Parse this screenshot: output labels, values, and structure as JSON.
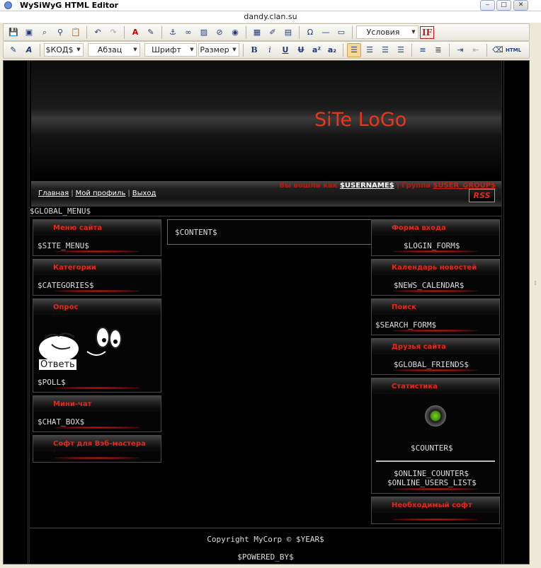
{
  "window": {
    "title": "WySiWyG HTML Editor",
    "url_label": "dandy.clan.su",
    "min_glyph": "‒",
    "max_glyph": "□",
    "close_glyph": "✕"
  },
  "toolbar1": {
    "condition_dropdown": "Условия",
    "if_label": "IF"
  },
  "toolbar2": {
    "code_dropdown": "$КОД$",
    "paragraph_dropdown": "Абзац",
    "font_dropdown": "Шрифт",
    "size_dropdown": "Размер",
    "bold": "B",
    "italic": "i",
    "underline": "U",
    "strike": "U",
    "superscript": "a²",
    "subscript": "a₂",
    "html_label": "HTML"
  },
  "header": {
    "logo_text": "SiTe LoGo"
  },
  "userbar": {
    "user_prefix": "Вы вошли как",
    "username": "$USERNAME$",
    "group_prefix": "| Группа",
    "group_value": "$USER_GROUP$",
    "nav": [
      "Главная",
      "Мой профиль",
      "Выход"
    ],
    "rss_label": "RSS"
  },
  "global_menu": "$GLOBAL_MENU$",
  "left_blocks": [
    {
      "title": "Меню сайта",
      "var": "$SITE_MENU$"
    },
    {
      "title": "Категории",
      "var": "$CATEGORIES$"
    },
    {
      "title": "Опрос",
      "var": "$POLL$",
      "image_word": "Ответь"
    },
    {
      "title": "Мини-чат",
      "var": "$CHAT_BOX$"
    },
    {
      "title": "Софт для Вэб-мастера",
      "var": ""
    }
  ],
  "content": "$CONTENT$",
  "right_blocks": [
    {
      "title": "Форма входа",
      "var": "$LOGIN_FORM$"
    },
    {
      "title": "Календарь новостей",
      "var": "$NEWS_CALENDAR$"
    },
    {
      "title": "Поиск",
      "var": "$SEARCH_FORM$"
    },
    {
      "title": "Друзья сайта",
      "var": "$GLOBAL_FRIENDS$"
    },
    {
      "title": "Статистика",
      "var": "$COUNTER$",
      "var2": "$ONLINE_COUNTER$",
      "var3": "$ONLINE_USERS_LIST$"
    },
    {
      "title": "Необходимый софт",
      "var": ""
    }
  ],
  "footer": {
    "copyright": "Copyright MyCorp © $YEAR$",
    "powered": "$POWERED_BY$"
  },
  "colors": {
    "accent_red": "#e5281a",
    "logo_red": "#e8371c",
    "editor_bg": "#000000",
    "chrome_bg": "#ece9d8"
  }
}
